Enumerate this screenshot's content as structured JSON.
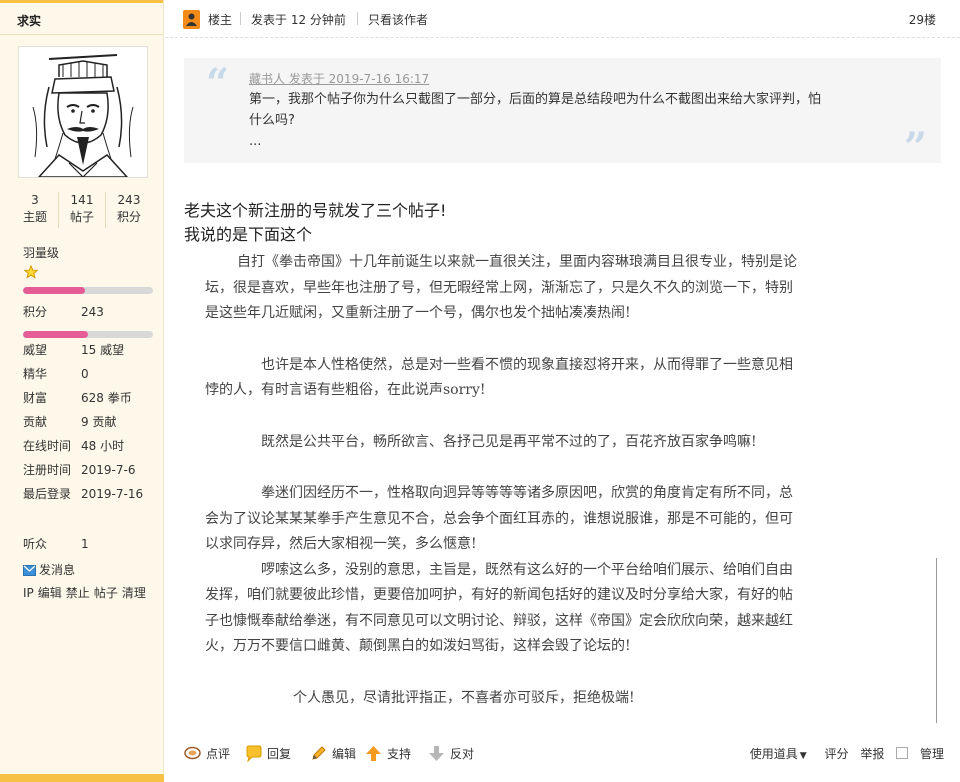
{
  "user": {
    "name": "求实",
    "stats": [
      {
        "value": "3",
        "label": "主题"
      },
      {
        "value": "141",
        "label": "帖子"
      },
      {
        "value": "243",
        "label": "积分"
      }
    ],
    "level": "羽量级",
    "level_progress_1": 0.48,
    "score_label": "积分",
    "score_value": "243",
    "level_progress_2": 0.5,
    "profile": [
      {
        "key": "威望",
        "value": "15 威望"
      },
      {
        "key": "精华",
        "value": "0"
      },
      {
        "key": "财富",
        "value": "628 拳币"
      },
      {
        "key": "贡献",
        "value": "9 贡献"
      },
      {
        "key": "在线时间",
        "value": "48 小时"
      },
      {
        "key": "注册时间",
        "value": "2019-7-6"
      },
      {
        "key": "最后登录",
        "value": "2019-7-16"
      }
    ],
    "listeners_label": "听众",
    "listeners_value": "1",
    "send_message": "发消息",
    "admin_links": [
      "IP",
      "编辑",
      "禁止",
      "帖子",
      "清理"
    ]
  },
  "post": {
    "owner_label": "楼主",
    "posted_at": "发表于 12 分钟前",
    "only_author": "只看该作者",
    "floor": "29楼",
    "quote": {
      "author": "藏书人",
      "posted": "发表于 2019-7-16 16:17",
      "line1": "第一，我那个帖子你为什么只截图了一部分，后面的算是总结段吧为什么不截图出来给大家评判，怕",
      "line2": "什么吗?",
      "line3": "..."
    },
    "title1": "老夫这个新注册的号就发了三个帖子!",
    "title2": "我说的是下面这个",
    "body": {
      "p1_l1": "自打《拳击帝国》十几年前诞生以来就一直很关注，里面内容琳琅满目且很专业，特别是论",
      "p1_l2": "坛，很是喜欢，早些年也注册了号，但无暇经常上网，渐渐忘了，只是久不久的浏览一下，特别",
      "p1_l3": "是这些年几近赋闲，又重新注册了一个号，偶尔也发个拙帖凑凑热闹!",
      "p2_l1": "也许是本人性格使然，总是对一些看不惯的现象直接怼将开来，从而得罪了一些意见相",
      "p2_l2": "悖的人，有时言语有些粗俗，在此说声sorry!",
      "p3_l1": "既然是公共平台，畅所欲言、各抒己见是再平常不过的了，百花齐放百家争鸣嘛!",
      "p4_l1": "拳迷们因经历不一，性格取向迥异等等等等诸多原因吧，欣赏的角度肯定有所不同，总",
      "p4_l2": "会为了议论某某某拳手产生意见不合，总会争个面红耳赤的，谁想说服谁，那是不可能的，但可",
      "p4_l3": "以求同存异，然后大家相视一笑，多么惬意!",
      "p5_l1": "啰嗦这么多，没别的意思，主旨是，既然有这么好的一个平台给咱们展示、给咱们自由",
      "p5_l2": "发挥，咱们就要彼此珍惜，更要倍加呵护，有好的新闻包括好的建议及时分享给大家，有好的帖",
      "p5_l3": "子也慷慨奉献给拳迷，有不同意见可以文明讨论、辩驳，这样《帝国》定会欣欣向荣，越来越红",
      "p5_l4": "火，万万不要信口雌黄、颠倒黑白的如泼妇骂街，这样会毁了论坛的!",
      "p6_l1": "个人愚见，尽请批评指正，不喜者亦可驳斥，拒绝极端!"
    }
  },
  "actions": {
    "rate": "点评",
    "reply": "回复",
    "edit": "编辑",
    "support": "支持",
    "oppose": "反对",
    "tools": "使用道具",
    "score": "评分",
    "report": "举报",
    "manage": "管理"
  },
  "colors": {
    "sidebar_bg": "#fdf8ea",
    "accent": "#f6c144",
    "progress_fill": "#e65c97",
    "quote_bg": "#f5f5f5"
  }
}
